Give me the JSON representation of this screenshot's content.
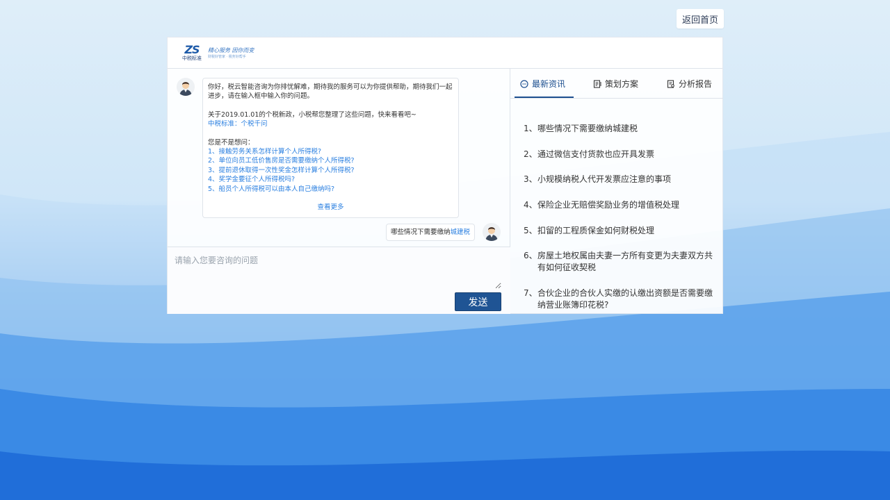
{
  "home_button": "返回首页",
  "logo": {
    "mark": "ZS",
    "name": "中税标准",
    "slogan_line1": "精心服务 因你而变",
    "slogan_line2": "财税好管家 · 税务好帮手"
  },
  "chat": {
    "bot_greeting": "你好，税云智能咨询为你排忧解难，期待我的服务可以为你提供帮助，期待我们一起进步，请在输入框中输入你的问题。",
    "bot_policy_intro": "关于2019.01.01的个税新政，小税帮您整理了这些问题，快来看看吧~",
    "bot_policy_link": "中税标准：个税千问",
    "bot_suggest_title": "您是不是想问：",
    "suggestions": [
      "1、接触劳务关系怎样计算个人所得税?",
      "2、单位向员工低价售房是否需要缴纳个人所得税?",
      "3、提前退休取得一次性奖金怎样计算个人所得税?",
      "4、奖学金要征个人所得税吗?",
      "5、船员个人所得税可以由本人自己缴纳吗?"
    ],
    "more_label": "查看更多",
    "user_message_prefix": "哪些情况下需要缴纳",
    "user_message_keyword": "城建税",
    "input_placeholder": "请输入您要咨询的问题",
    "send_label": "发送"
  },
  "tabs": [
    {
      "label": "最新资讯",
      "icon": "message-icon",
      "active": true
    },
    {
      "label": "策划方案",
      "icon": "document-icon",
      "active": false
    },
    {
      "label": "分析报告",
      "icon": "report-icon",
      "active": false
    }
  ],
  "news": [
    {
      "num": "1、",
      "text": "哪些情况下需要缴纳城建税"
    },
    {
      "num": "2、",
      "text": "通过微信支付货款也应开具发票"
    },
    {
      "num": "3、",
      "text": "小规模纳税人代开发票应注意的事项"
    },
    {
      "num": "4、",
      "text": "保险企业无赔偿奖励业务的增值税处理"
    },
    {
      "num": "5、",
      "text": "扣留的工程质保金如何财税处理"
    },
    {
      "num": "6、",
      "text": "房屋土地权属由夫妻一方所有变更为夫妻双方共有如何征收契税"
    },
    {
      "num": "7、",
      "text": "合伙企业的合伙人实缴的认缴出资额是否需要缴纳营业账簿印花税?"
    }
  ],
  "colors": {
    "accent": "#1d4f8f",
    "link": "#2a7fe0",
    "send_button": "#1f5494"
  }
}
